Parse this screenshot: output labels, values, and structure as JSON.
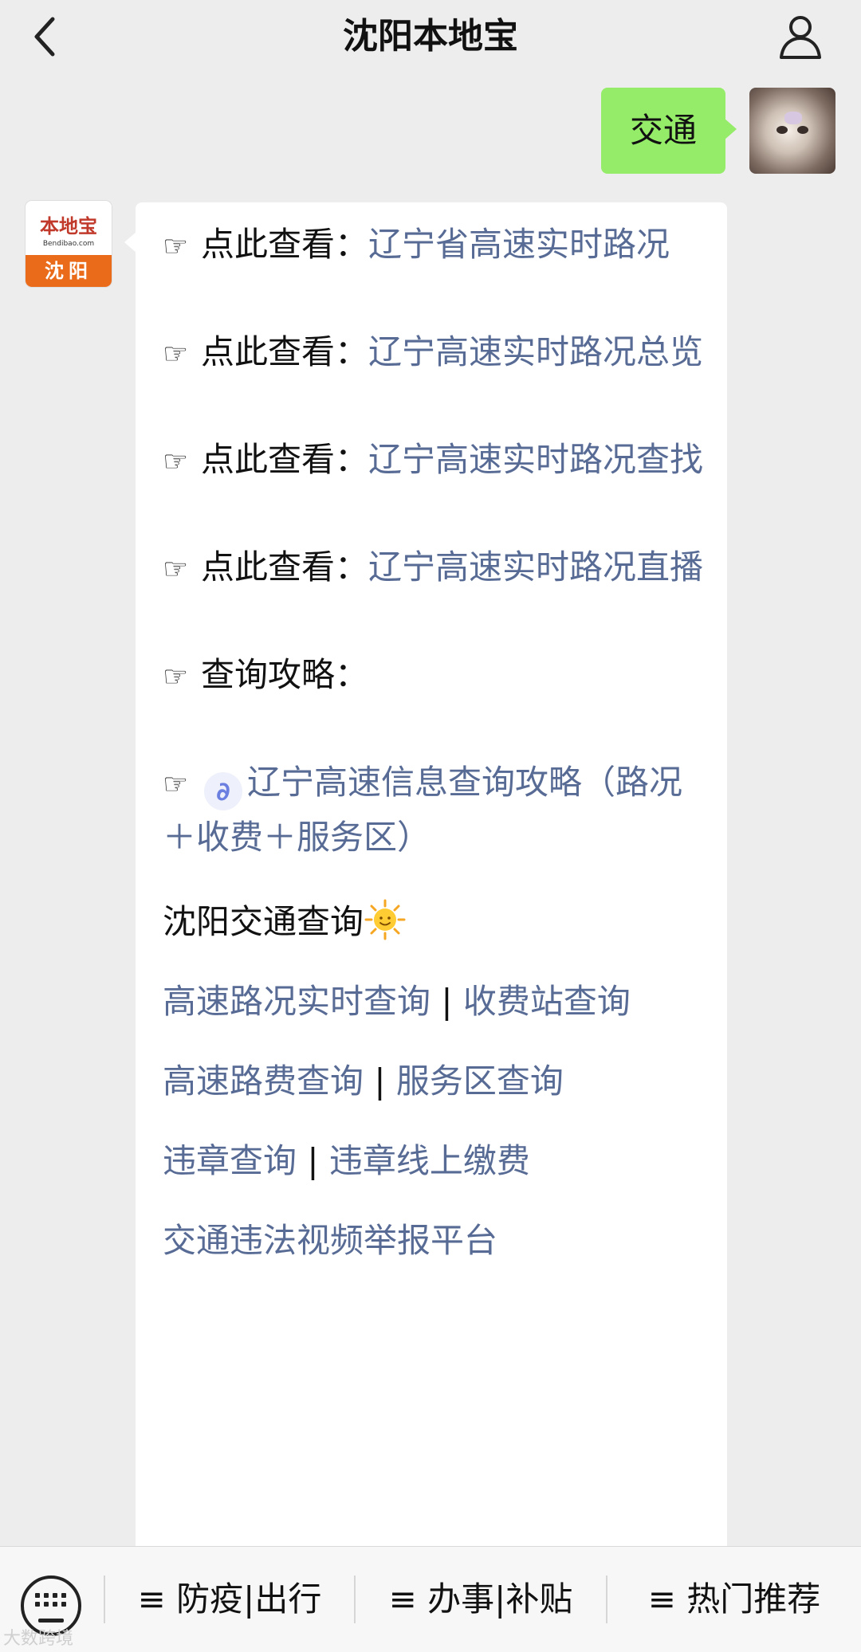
{
  "header": {
    "title": "沈阳本地宝"
  },
  "outgoing": {
    "text": "交通"
  },
  "bot_avatar": {
    "logo_text": "本地宝",
    "logo_sub": "Bendibao.com",
    "city": "沈阳"
  },
  "message": {
    "hand": "☞",
    "view_prefix": "点此查看：",
    "links": [
      "辽宁省高速实时路况",
      "辽宁高速实时路况总览",
      "辽宁高速实时路况查找",
      "辽宁高速实时路况直播"
    ],
    "guide_label": "查询攻略：",
    "miniprogram_link": "辽宁高速信息查询攻略（路况＋收费＋服务区）",
    "section_title": "沈阳交通查询",
    "link_pairs": [
      [
        "高速路况实时查询",
        "收费站查询"
      ],
      [
        "高速路费查询",
        "服务区查询"
      ],
      [
        "违章查询",
        "违章线上缴费"
      ]
    ],
    "pair_separator": " | ",
    "last_link": "交通违法视频举报平台"
  },
  "menu": {
    "items": [
      "≡ 防疫|出行",
      "≡ 办事|补贴",
      "≡ 热门推荐"
    ]
  },
  "watermark": "大数跨境"
}
